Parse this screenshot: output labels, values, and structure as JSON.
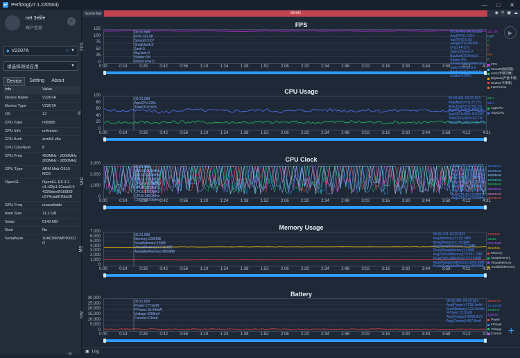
{
  "app": {
    "title": "PerfDog(v7.1.220504)"
  },
  "user": {
    "name": "net 3elife",
    "account_label": "账户信息"
  },
  "device": {
    "name": "V2207A"
  },
  "app_select": {
    "placeholder": "请选择测试应用"
  },
  "tabs": [
    "Device",
    "Setting",
    "About"
  ],
  "info_table": {
    "headers": [
      "Info",
      "Value"
    ],
    "rows": [
      [
        "Device Name",
        "V2207A"
      ],
      [
        "Device Type",
        "V2207A"
      ],
      [
        "OS",
        "12"
      ],
      [
        "CPU Type",
        "mt6895"
      ],
      [
        "CPU Info",
        "unknown"
      ],
      [
        "CPU Arch",
        "arm64-v8a"
      ],
      [
        "CPU CoreNum",
        "8"
      ],
      [
        "CPU Freq",
        "450MHz - 2000MHz\n200MHz - 2850MHz"
      ],
      [
        "GPU Type",
        "ARM Mali-G610\nMC6"
      ],
      [
        "OpenGL",
        "OpenGL ES 3.2\nv1.r32p1-01eac0.5\n4329dee8f160f28\nc574caaf67bbe3f"
      ],
      [
        "GPU Freq",
        "unavailable"
      ],
      [
        "Ram Size",
        "11.2 GB"
      ],
      [
        "Swap",
        "6143 MB"
      ],
      [
        "Root",
        "No"
      ],
      [
        "SerialNum",
        "10AC590WBY000J\nO"
      ]
    ]
  },
  "scene": {
    "label": "SceneTab",
    "selected": "label1"
  },
  "x_ticks": [
    "0:00",
    "0:14",
    "0:28",
    "0:42",
    "0:56",
    "1:10",
    "1:24",
    "1:38",
    "1:52",
    "2:06",
    "2:20",
    "2:34",
    "2:48",
    "3:02",
    "3:16",
    "3:30",
    "3:44",
    "3:58",
    "4:12",
    "4:31"
  ],
  "panels": [
    {
      "key": "fps",
      "title": "FPS",
      "ylabel": "FPS",
      "yticks": [
        "125",
        "100",
        "75",
        "50",
        "25",
        "0"
      ],
      "overlay_left": "00:21.999\nFPS:121.08\nSmooth:0.07\nSmallJank:0\nJank:0\nBigJank:0\nStutter:0%\nInterFrame:0",
      "overlay_right": "00:00.401-04:25.823\nAvg(FPS):119.4\nVar(FPS):0.03\n≥Avg(FPS):99.8%\nDrop(FPS):0\nJank(/10min):0\nBigJank(/10min):0\nStutter:0%\nSmallJank(/10min):0.0\nJank(/10min):0.0\nBigJank(/10min):0.0\nStutter:0.00%",
      "legend": [
        [
          "121.08",
          "#d22ef0"
        ],
        [
          "0.07",
          "#5ac8fa"
        ],
        [
          "0",
          "#22c55e"
        ],
        [
          "0",
          "#eab308"
        ],
        [
          "0",
          "#ef4444"
        ],
        [
          "0%",
          "#f97316"
        ],
        [
          "0",
          "#a3a3a3"
        ]
      ],
      "legend_names": [
        "FPS",
        "Smooth(帧间隔)",
        "Jank(卡顿次数)",
        "BigJank(严重卡顿)",
        "Stutter(卡顿率)",
        "InterFrame"
      ]
    },
    {
      "key": "cpu",
      "title": "CPU Usage",
      "ylabel": "%",
      "yticks": [
        "100",
        "80",
        "60",
        "40",
        "20",
        "0"
      ],
      "overlay_left": "00:21.999\nAppCPU:23%\nTotalCPU:56%",
      "overlay_right": "00:00.401-04:25.823\nAvg(AppCPU):22.7%\nAvg(TotalCPU):58.2%\nAppCPU≤60%:100.0%\nAppCPU≤80%:100.0%\nTotalCPU≤60%:63.7%\nTotalCPU≤80%:100.0%",
      "legend": [
        [
          "23%",
          "#22c55e"
        ],
        [
          "56%",
          "#5a6fff"
        ]
      ],
      "legend_names": [
        "AppCPU",
        "TotalCPU"
      ]
    },
    {
      "key": "clock",
      "title": "CPU Clock",
      "ylabel": "MHz",
      "yticks": [
        "3,000",
        "2,000",
        "1,000",
        "0"
      ],
      "overlay_left": "00:21.999\nCPU0:1000MHz\nCPU1:1000MHz\nCPU2:1000MHz\nCPU3:1000MHz\nCPU4:2850MHz\nCPU5:2850MHz\nCPU6:2850MHz\nCPU7:2730MHz",
      "overlay_right": "00:00.401-04:25.823\nAvg(CPU0):1227MHz\nAvg(CPU1):1227MHz\nAvg(CPU2):1227MHz\nAvg(CPU3):1227MHz\nAvg(CPU4):1783MHz\nAvg(CPU5):1783MHz\nAvg(CPU6):1783MHz\nAvg(CPU7):1762MHz",
      "legend": [
        [
          "1000MHz",
          "#3b82f6"
        ],
        [
          "1000MHz",
          "#60a5fa"
        ],
        [
          "1000MHz",
          "#93c5fd"
        ],
        [
          "1000MHz",
          "#2dd4bf"
        ],
        [
          "2850MHz",
          "#22c55e"
        ],
        [
          "2850MHz",
          "#a855f7"
        ],
        [
          "2850MHz",
          "#f472b6"
        ],
        [
          "2730MHz",
          "#ef4444"
        ]
      ],
      "legend_names": []
    },
    {
      "key": "mem",
      "title": "Memory Usage",
      "ylabel": "MB",
      "yticks": [
        "7,000",
        "6,000",
        "5,000",
        "4,000",
        "3,000",
        "2,000",
        "1,000",
        "0"
      ],
      "overlay_left": "00:21.999\nMemory:1285MB\nSwapMemory:13MB\nVirtualMemory:57011MB\nAvailableMemory:3869MB",
      "overlay_right": "00:00.401-04:25.823\nAvg(Memory):1228.7MB\nPeak(Memory):1303MB\nAvg(SwapMemory):13.9MB\nPeak(SwapMemory):14MB\nAvg(VirtualMemory):57091.1MB\nPeak(VirtualMemory):57210MB\nAvg(AvailableMemory):3958.8MB\nPeak(AvailableMemory):3864MB",
      "legend": [
        [
          "1285MB",
          "#ef4444"
        ],
        [
          "13MB",
          "#22c55e"
        ],
        [
          "57011MB",
          "#a855f7"
        ],
        [
          "3840MB",
          "#eab308"
        ]
      ],
      "legend_names": [
        "Memory",
        "SwapMemory",
        "VirtualMemory",
        "AvailableMemory"
      ]
    },
    {
      "key": "bat",
      "title": "Battery",
      "ylabel": "mW",
      "yticks": [
        "30,000",
        "25,000",
        "20,000",
        "15,000",
        "10,000",
        "5,000",
        "0"
      ],
      "overlay_left": "00:21.600\nPower:1771mW\nFPower:15.34mW\nVoltage:4268mV\nCurrent:416mA",
      "overlay_right": "00:00.401-04:25.823\nAvg(Power):1728.1mW\nSum(Battery):123.2mWh\nFPower:15.3mW\nAvg(Voltage):4268.8mV\nAvg(Current):407.8mA",
      "legend": [
        [
          "1820mW",
          "#ef4444"
        ],
        [
          "15.34mW",
          "#3b82f6"
        ],
        [
          "4268mV",
          "#22c55e"
        ],
        [
          "416mA",
          "#a855f7"
        ]
      ],
      "legend_names": [
        "Power",
        "FPower",
        "Voltage",
        "Current"
      ]
    }
  ],
  "chart_data": [
    {
      "type": "line",
      "title": "FPS",
      "ylim": [
        0,
        125
      ],
      "series": [
        {
          "name": "FPS",
          "values": [
            120,
            121,
            120,
            121,
            120,
            121,
            120,
            119,
            121,
            120,
            121,
            120,
            121,
            120,
            120,
            121,
            120,
            121,
            120,
            120
          ]
        }
      ]
    },
    {
      "type": "line",
      "title": "CPU Usage",
      "ylim": [
        0,
        100
      ],
      "series": [
        {
          "name": "AppCPU",
          "values": [
            23,
            22,
            23,
            22,
            24,
            23,
            22,
            23,
            22,
            23,
            22,
            23,
            24,
            23,
            22,
            23,
            22,
            23,
            22,
            23
          ]
        },
        {
          "name": "TotalCPU",
          "values": [
            60,
            56,
            58,
            52,
            60,
            58,
            56,
            57,
            59,
            55,
            58,
            60,
            57,
            58,
            56,
            59,
            57,
            58,
            56,
            58
          ]
        }
      ]
    },
    {
      "type": "line",
      "title": "CPU Clock",
      "ylim": [
        0,
        3000
      ],
      "series": [
        {
          "name": "CPU0",
          "values": [
            1000,
            1400,
            900,
            1600,
            1000,
            1800,
            1100,
            1200,
            1300,
            900,
            1500,
            1000,
            1400,
            1200,
            1600,
            1100,
            1300,
            1000,
            1200,
            1000
          ]
        },
        {
          "name": "CPU4",
          "values": [
            2850,
            1500,
            2600,
            1200,
            2850,
            1900,
            2400,
            1300,
            2850,
            2000,
            1600,
            2850,
            1400,
            2500,
            1700,
            2850,
            1800,
            2200,
            1500,
            2850
          ]
        }
      ]
    },
    {
      "type": "line",
      "title": "Memory Usage",
      "ylim": [
        0,
        7000
      ],
      "series": [
        {
          "name": "Memory",
          "values": [
            1285,
            1290,
            1230,
            1240,
            1220,
            1250,
            1230,
            1240,
            1220,
            1230,
            1240,
            1230,
            1220,
            1250,
            1230,
            1240,
            1230,
            1220,
            1230,
            1240
          ]
        },
        {
          "name": "AvailableMemory",
          "values": [
            3869,
            3870,
            3860,
            3900,
            3950,
            3940,
            3960,
            3950,
            3970,
            3960,
            3950,
            3960,
            3970,
            3960,
            3950,
            3960,
            3970,
            3960,
            3950,
            3960
          ]
        }
      ]
    },
    {
      "type": "line",
      "title": "Battery",
      "ylim": [
        0,
        30000
      ],
      "series": [
        {
          "name": "Power",
          "values": [
            1771,
            1700,
            1800,
            1650,
            1750,
            1720,
            1780,
            1690,
            1740,
            1710,
            1760,
            1700,
            1730,
            1720,
            1750,
            1700,
            1740,
            1720,
            1730,
            1728
          ]
        }
      ]
    }
  ],
  "log": {
    "label": "Log"
  }
}
